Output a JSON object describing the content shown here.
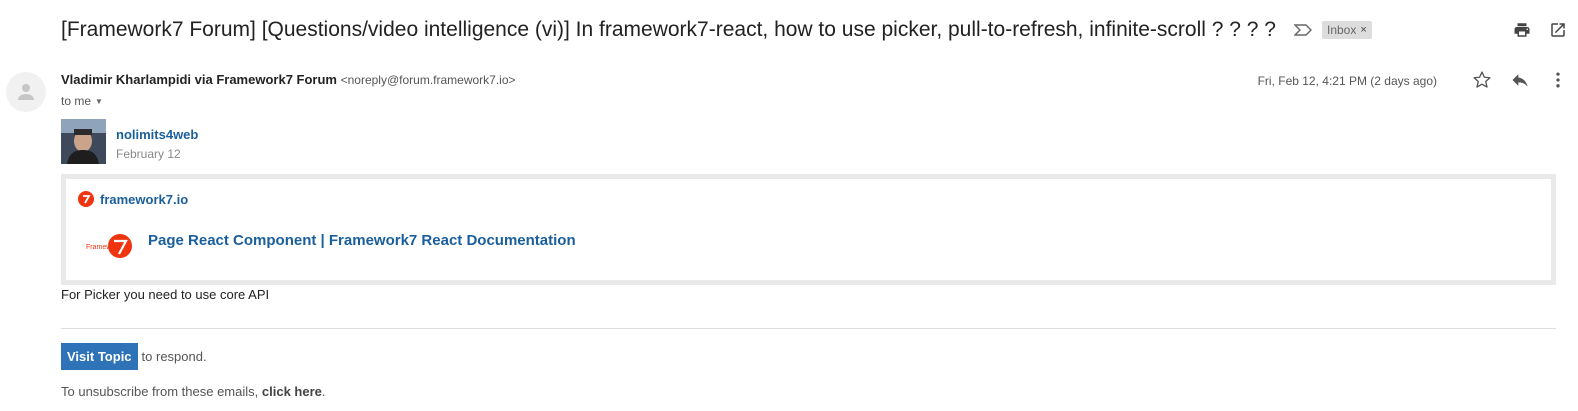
{
  "header": {
    "subject": "[Framework7 Forum] [Questions/video intelligence (vi)] In framework7-react, how to use picker, pull-to-refresh, infinite-scroll ? ? ? ?",
    "label_chip": "Inbox",
    "label_chip_close": "×"
  },
  "message": {
    "sender_name": "Vladimir Kharlampidi via Framework7 Forum",
    "sender_email": "<noreply@forum.framework7.io>",
    "recipient": "to me",
    "date": "Fri, Feb 12, 4:21 PM (2 days ago)"
  },
  "post": {
    "author": "nolimits4web",
    "date": "February 12"
  },
  "onebox": {
    "source": "framework7.io",
    "title": "Page React Component | Framework7 React Documentation",
    "thumb_text": "Framework"
  },
  "body": {
    "text": "For Picker you need to use core API"
  },
  "footer": {
    "visit_button": "Visit Topic",
    "visit_suffix": "to respond.",
    "unsub_prefix": "To unsubscribe from these emails,",
    "unsub_link": "click here",
    "unsub_suffix": "."
  },
  "colors": {
    "link_blue": "#1a5f9c",
    "button_blue": "#2e73b8",
    "framework7_red": "#ee350f"
  },
  "icons": [
    "important-marker-icon",
    "print-icon",
    "open-new-window-icon",
    "default-avatar-icon",
    "star-icon",
    "reply-icon",
    "more-vert-icon",
    "framework7-logo-icon"
  ]
}
